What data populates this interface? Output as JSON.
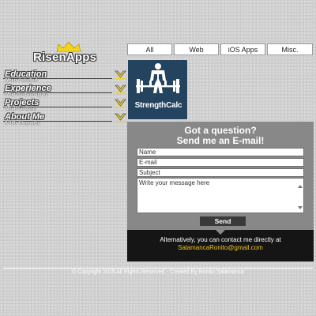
{
  "logo": {
    "text": "RisenApps",
    "crown_color": "#f2d21c"
  },
  "nav": {
    "chevron_color": "#f2d21c",
    "items": [
      {
        "title": "Education",
        "subtitle": "Where I studied."
      },
      {
        "title": "Experience",
        "subtitle": "What I've been up to."
      },
      {
        "title": "Projects",
        "subtitle": "What I've done."
      },
      {
        "title": "About Me",
        "subtitle": "A little biography"
      }
    ]
  },
  "tabs": [
    "All",
    "Web",
    "iOS Apps",
    "Misc."
  ],
  "project": {
    "label": "StrengthCalc",
    "bg_color": "#24435e"
  },
  "contact": {
    "heading_line1": "Got a question?",
    "heading_line2": "Send me an E-mail!",
    "name_placeholder": "Name",
    "email_placeholder": "E-mail",
    "subject_placeholder": "Subject",
    "message_placeholder": "Write your message here",
    "send_label": "Send",
    "alt_text": "Alternatively, you can contact me directly at",
    "email_address": "SalamancaRonito@gmail.com",
    "email_color": "#f2c21a"
  },
  "footer": {
    "text": "© Copyright 2015 All Rights Reserved - Created By Ronito Salamanca"
  }
}
